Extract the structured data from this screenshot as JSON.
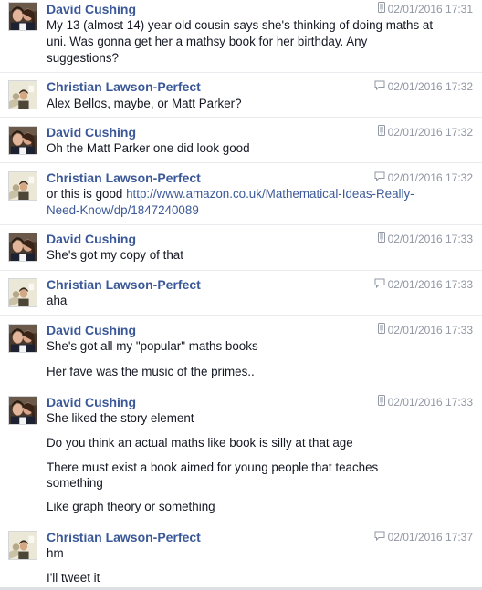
{
  "messages": [
    {
      "sender": "David Cushing",
      "time": "02/01/2016 17:31",
      "device": "mobile",
      "lines": [
        "My 13 (almost 14) year old cousin says she's thinking of doing maths at",
        "uni. Was gonna get her a mathsy book for her birthday. Any",
        "suggestions?"
      ]
    },
    {
      "sender": "Christian Lawson-Perfect",
      "time": "02/01/2016 17:32",
      "device": "web",
      "lines": [
        "Alex Bellos, maybe, or Matt Parker?"
      ]
    },
    {
      "sender": "David Cushing",
      "time": "02/01/2016 17:32",
      "device": "mobile",
      "lines": [
        "Oh the Matt Parker one did look good"
      ]
    },
    {
      "sender": "Christian Lawson-Perfect",
      "time": "02/01/2016 17:32",
      "device": "web",
      "text_before_link": "or this is good ",
      "link_line1": "http://www.amazon.co.uk/Mathematical-Ideas-Really-",
      "link_line2": "Need-Know/dp/1847240089"
    },
    {
      "sender": "David Cushing",
      "time": "02/01/2016 17:33",
      "device": "mobile",
      "lines": [
        "She's got my copy of that"
      ]
    },
    {
      "sender": "Christian Lawson-Perfect",
      "time": "02/01/2016 17:33",
      "device": "web",
      "lines": [
        "aha"
      ]
    },
    {
      "sender": "David Cushing",
      "time": "02/01/2016 17:33",
      "device": "mobile",
      "lines": [
        "She's got all my \"popular\" maths books",
        "Her fave was the music of the primes.."
      ]
    },
    {
      "sender": "David Cushing",
      "time": "02/01/2016 17:33",
      "device": "mobile",
      "lines": [
        "She liked the story element",
        "Do you think an actual maths like book is silly at that age",
        "There must exist a book aimed for young people that teaches",
        "something",
        "Like graph theory or something"
      ]
    },
    {
      "sender": "Christian Lawson-Perfect",
      "time": "02/01/2016 17:37",
      "device": "web",
      "lines": [
        "hm",
        "I'll tweet it"
      ]
    }
  ],
  "colors": {
    "name": "#3b5998",
    "text": "#141823",
    "meta": "#9197a3",
    "link": "#3b5998"
  }
}
